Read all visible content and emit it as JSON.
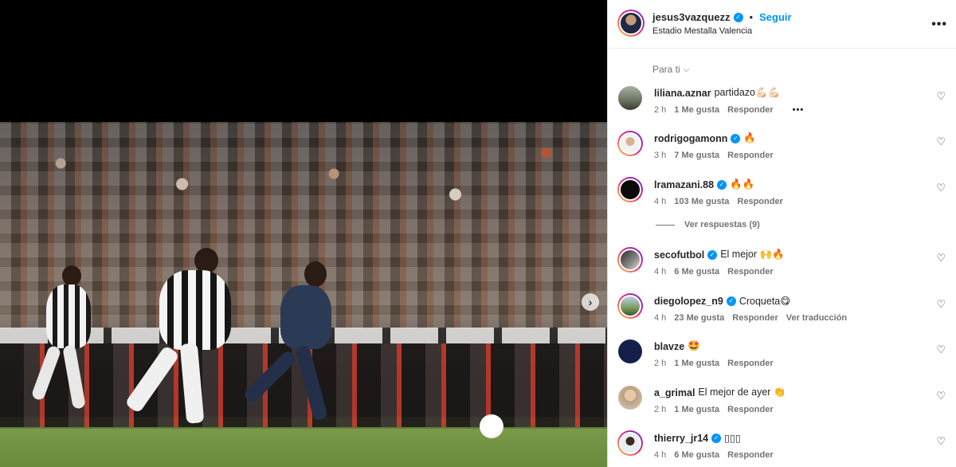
{
  "post": {
    "username": "jesus3vazquezz",
    "follow_label": "Seguir",
    "location": "Estadio Mestalla Valencia",
    "more_label": "•••"
  },
  "comments_filter": {
    "label": "Para ti",
    "chevron": "chevron-down-icon"
  },
  "comments": [
    {
      "user": "liliana.aznar",
      "verified": false,
      "text": "partidazo💪🏻💪🏻",
      "time": "2 h",
      "likes": "1 Me gusta",
      "reply": "Responder",
      "extra": "•••"
    },
    {
      "user": "rodrigogamonn",
      "verified": true,
      "text": "🔥",
      "time": "3 h",
      "likes": "7 Me gusta",
      "reply": "Responder",
      "extra": ""
    },
    {
      "user": "lramazani.88",
      "verified": true,
      "text": "🔥🔥",
      "time": "4 h",
      "likes": "103 Me gusta",
      "reply": "Responder",
      "extra": ""
    },
    {
      "user": "secofutbol",
      "verified": true,
      "text": "El mejor 🙌🔥",
      "time": "4 h",
      "likes": "6 Me gusta",
      "reply": "Responder",
      "extra": ""
    },
    {
      "user": "diegolopez_n9",
      "verified": true,
      "text": "Croqueta😋",
      "time": "4 h",
      "likes": "23 Me gusta",
      "reply": "Responder",
      "extra": "Ver traducción"
    },
    {
      "user": "blavze",
      "verified": false,
      "text": "🤩",
      "time": "2 h",
      "likes": "1 Me gusta",
      "reply": "Responder",
      "extra": ""
    },
    {
      "user": "a_grimal",
      "verified": false,
      "text": "El mejor de ayer 👏",
      "time": "2 h",
      "likes": "1 Me gusta",
      "reply": "Responder",
      "extra": ""
    },
    {
      "user": "thierry_jr14",
      "verified": true,
      "text": "▯▯▯",
      "time": "4 h",
      "likes": "6 Me gusta",
      "reply": "Responder",
      "extra": ""
    }
  ],
  "view_replies": "Ver respuestas (9)",
  "colors": {
    "link_blue": "#0095f6",
    "meta_gray": "#737373",
    "text": "#262626"
  }
}
